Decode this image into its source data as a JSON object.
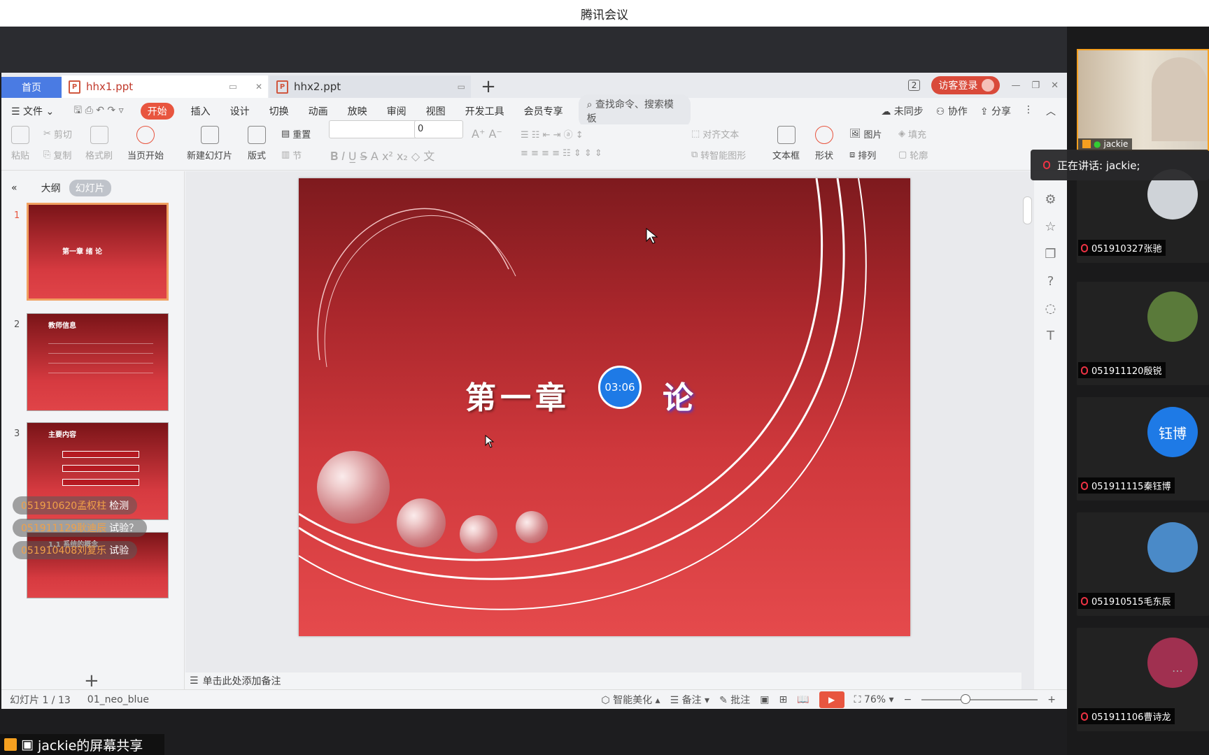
{
  "window": {
    "title": "腾讯会议"
  },
  "tabs": {
    "home": "首页",
    "doc1": "hhx1.ppt",
    "doc2": "hhx2.ppt",
    "doc_count": "2",
    "login": "访客登录"
  },
  "menu": {
    "file": "文件",
    "items": [
      "开始",
      "插入",
      "设计",
      "切换",
      "动画",
      "放映",
      "审阅",
      "视图",
      "开发工具",
      "会员专享"
    ],
    "search": "查找命令、搜索模板",
    "sync": "未同步",
    "collab": "协作",
    "share": "分享"
  },
  "ribbon": {
    "paste": "粘贴",
    "cut": "剪切",
    "copy": "复制",
    "format_brush": "格式刷",
    "play_current": "当页开始",
    "new_slide": "新建幻灯片",
    "layout": "版式",
    "reset": "重置",
    "section": "节",
    "font_size": "0",
    "align_text": "对齐文本",
    "smart_shape": "转智能图形",
    "textbox": "文本框",
    "shape": "形状",
    "picture": "图片",
    "arrange": "排列",
    "fill": "填充",
    "outline": "轮廓"
  },
  "left_panel": {
    "tab_outline": "大纲",
    "tab_slides": "幻灯片",
    "thumbs": [
      {
        "num": "1",
        "title": "第一章  绪 论"
      },
      {
        "num": "2",
        "title": "教师信息"
      },
      {
        "num": "3",
        "title": "主要内容"
      },
      {
        "num": "4",
        "title": "1.1 系统的概念"
      }
    ]
  },
  "chat": [
    {
      "user": "051910620孟权柱",
      "msg": "检测"
    },
    {
      "user": "051911129耿迪辰",
      "msg": "试验？"
    },
    {
      "user": "051910408刘复乐",
      "msg": "试验"
    }
  ],
  "slide": {
    "title": "第一章",
    "title2": "论",
    "timer": "03:06"
  },
  "notes": "单击此处添加备注",
  "status": {
    "slide_pos": "幻灯片 1 / 13",
    "theme": "01_neo_blue",
    "beautify": "智能美化",
    "notes": "备注",
    "comment": "批注",
    "zoom": "76%"
  },
  "screen_share": "jackie的屏幕共享",
  "participants": {
    "host": "jackie",
    "speaking": "正在讲话: jackie;",
    "list": [
      {
        "name": "051910327张驰",
        "color": "#cfd3d8"
      },
      {
        "name": "051911120殷锐",
        "color": "#5a7a3a"
      },
      {
        "name": "051911115秦钰博",
        "avatar_text": "钰博",
        "color": "#1e7ae6"
      },
      {
        "name": "051910515毛东辰",
        "color": "#4a8ac8"
      },
      {
        "name": "051911106曹诗龙",
        "color": "#a03050"
      }
    ]
  }
}
